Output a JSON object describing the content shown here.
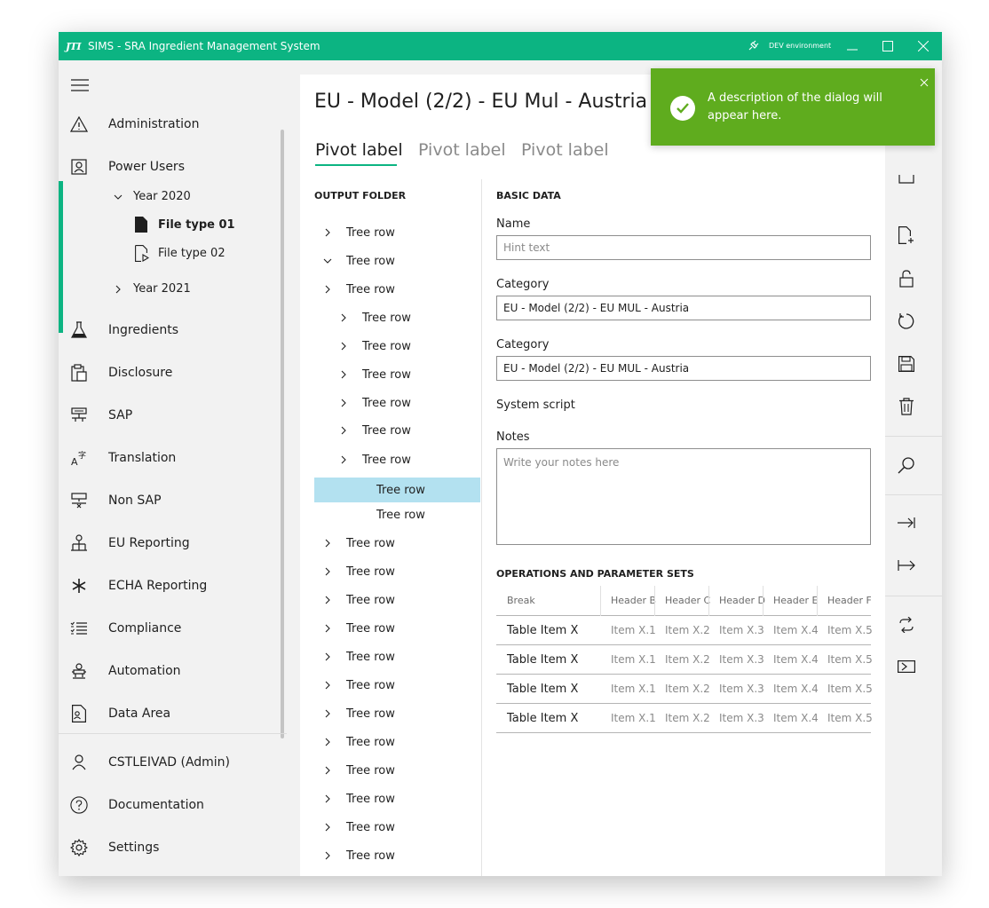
{
  "window": {
    "logo": "JTI",
    "title": "SIMS - SRA Ingredient Management System",
    "environment": "DEV environment",
    "accent": "#0cb482"
  },
  "sidebar": {
    "items": [
      {
        "label": "Administration",
        "icon": "warning-icon"
      },
      {
        "label": "Power Users",
        "icon": "user-badge-icon"
      },
      {
        "label": "Ingredients",
        "icon": "flask-icon"
      },
      {
        "label": "Disclosure",
        "icon": "clipboard-icon"
      },
      {
        "label": "SAP",
        "icon": "network-icon"
      },
      {
        "label": "Translation",
        "icon": "translate-icon"
      },
      {
        "label": "Non SAP",
        "icon": "network-off-icon"
      },
      {
        "label": "EU Reporting",
        "icon": "hierarchy-icon"
      },
      {
        "label": "ECHA Reporting",
        "icon": "asterisk-icon"
      },
      {
        "label": "Compliance",
        "icon": "list-icon"
      },
      {
        "label": "Automation",
        "icon": "robot-icon"
      },
      {
        "label": "Data Area",
        "icon": "document-user-icon"
      }
    ],
    "tree": {
      "year_2020": "Year 2020",
      "file_type_01": "File type 01",
      "file_type_02": "File type 02",
      "year_2021": "Year 2021"
    },
    "footer": [
      {
        "label": "CSTLEIVAD (Admin)",
        "icon": "person-icon"
      },
      {
        "label": "Documentation",
        "icon": "help-icon"
      },
      {
        "label": "Settings",
        "icon": "gear-icon"
      }
    ]
  },
  "page": {
    "title": "EU - Model (2/2) - EU Mul - Austria",
    "pivots": [
      "Pivot label",
      "Pivot label",
      "Pivot label"
    ]
  },
  "tree_panel": {
    "heading": "OUTPUT FOLDER",
    "rows": [
      {
        "label": "Tree row",
        "level": 0,
        "state": "collapsed"
      },
      {
        "label": "Tree row",
        "level": 0,
        "state": "expanded"
      },
      {
        "label": "Tree row",
        "level": 0,
        "state": "collapsed"
      },
      {
        "label": "Tree row",
        "level": 1,
        "state": "collapsed"
      },
      {
        "label": "Tree row",
        "level": 1,
        "state": "collapsed"
      },
      {
        "label": "Tree row",
        "level": 1,
        "state": "collapsed"
      },
      {
        "label": "Tree row",
        "level": 1,
        "state": "collapsed"
      },
      {
        "label": "Tree row",
        "level": 1,
        "state": "collapsed"
      },
      {
        "label": "Tree row",
        "level": 1,
        "state": "collapsed"
      },
      {
        "label": "Tree row",
        "level": 2,
        "state": "leaf",
        "selected": true
      },
      {
        "label": "Tree row",
        "level": 2,
        "state": "leaf"
      },
      {
        "label": "Tree row",
        "level": 0,
        "state": "collapsed"
      },
      {
        "label": "Tree row",
        "level": 0,
        "state": "collapsed"
      },
      {
        "label": "Tree row",
        "level": 0,
        "state": "collapsed"
      },
      {
        "label": "Tree row",
        "level": 0,
        "state": "collapsed"
      },
      {
        "label": "Tree row",
        "level": 0,
        "state": "collapsed"
      },
      {
        "label": "Tree row",
        "level": 0,
        "state": "collapsed"
      },
      {
        "label": "Tree row",
        "level": 0,
        "state": "collapsed"
      },
      {
        "label": "Tree row",
        "level": 0,
        "state": "collapsed"
      },
      {
        "label": "Tree row",
        "level": 0,
        "state": "collapsed"
      },
      {
        "label": "Tree row",
        "level": 0,
        "state": "collapsed"
      },
      {
        "label": "Tree row",
        "level": 0,
        "state": "collapsed"
      },
      {
        "label": "Tree row",
        "level": 0,
        "state": "collapsed"
      }
    ]
  },
  "form": {
    "heading": "BASIC DATA",
    "name_label": "Name",
    "name_placeholder": "Hint text",
    "category1_label": "Category",
    "category1_value": "EU - Model (2/2) - EU MUL - Austria",
    "category2_label": "Category",
    "category2_value": "EU - Model (2/2) - EU MUL - Austria",
    "system_script_label": "System script",
    "notes_label": "Notes",
    "notes_placeholder": "Write your notes here"
  },
  "operations": {
    "heading": "OPERATIONS AND PARAMETER SETS",
    "headers": [
      "Break",
      "Header B",
      "Header C",
      "Header D",
      "Header E",
      "Header F"
    ],
    "rows": [
      [
        "Table Item X",
        "Item X.1",
        "Item X.2",
        "Item X.3",
        "Item X.4",
        "Item X.5"
      ],
      [
        "Table Item X",
        "Item X.1",
        "Item X.2",
        "Item X.3",
        "Item X.4",
        "Item X.5"
      ],
      [
        "Table Item X",
        "Item X.1",
        "Item X.2",
        "Item X.3",
        "Item X.4",
        "Item X.5"
      ],
      [
        "Table Item X",
        "Item X.1",
        "Item X.2",
        "Item X.3",
        "Item X.4",
        "Item X.5"
      ]
    ]
  },
  "command_bar": [
    "filter-icon",
    "new-document-icon",
    "unlock-icon",
    "refresh-icon",
    "save-icon",
    "delete-icon",
    "search-icon",
    "indent-right-icon",
    "outdent-icon",
    "sync-icon",
    "run-icon"
  ],
  "toast": {
    "message": "A description of the dialog will appear here.",
    "color": "#5fac1e"
  }
}
